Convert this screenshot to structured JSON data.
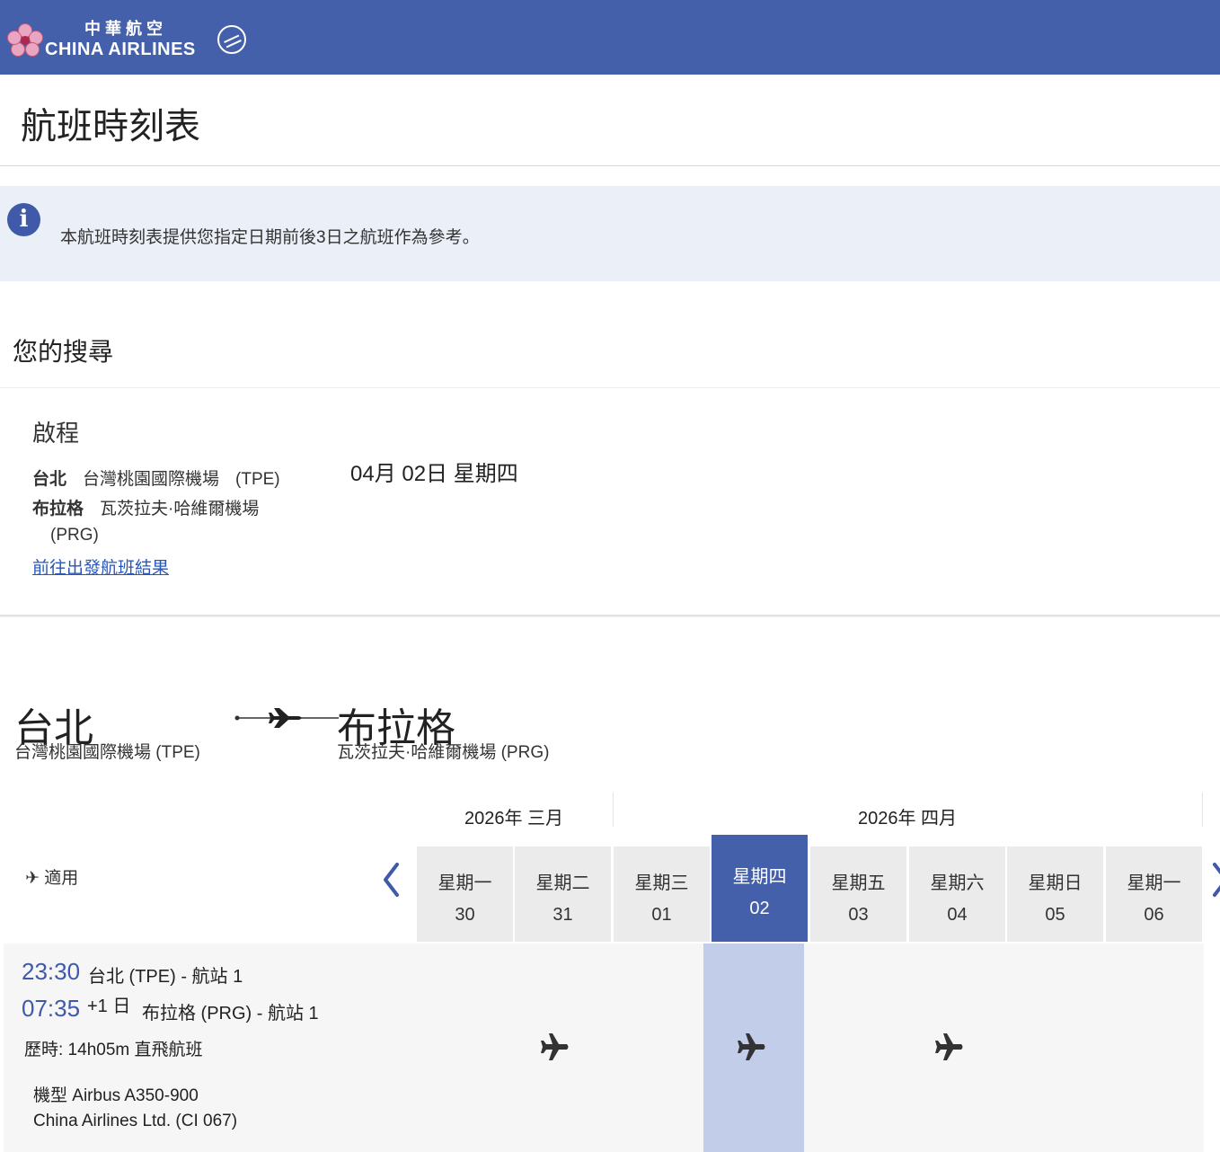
{
  "header": {
    "logo_cn": "中華航空",
    "logo_en": "CHINA AIRLINES",
    "brand_color": "#4560ab"
  },
  "page": {
    "title": "航班時刻表"
  },
  "info": {
    "icon": "info-icon",
    "text": "本航班時刻表提供您指定日期前後3日之航班作為參考。"
  },
  "search": {
    "heading": "您的搜尋",
    "leg_title": "啟程",
    "origin_city": "台北",
    "origin_airport": "台灣桃園國際機場",
    "origin_code": "(TPE)",
    "dest_city": "布拉格",
    "dest_airport": "瓦茨拉夫·哈維爾機場",
    "dest_code": "(PRG)",
    "date": "04月 02日 星期四",
    "link": "前往出發航班結果"
  },
  "route": {
    "from_city": "台北",
    "from_airport": "台灣桃園國際機場 (TPE)",
    "to_city": "布拉格",
    "to_airport": "瓦茨拉夫·哈維爾機場 (PRG)"
  },
  "calendar": {
    "months": [
      "2026年 三月",
      "2026年 四月"
    ],
    "filter_label": "適用",
    "days": [
      {
        "dow": "星期一",
        "num": "30"
      },
      {
        "dow": "星期二",
        "num": "31"
      },
      {
        "dow": "星期三",
        "num": "01"
      },
      {
        "dow": "星期四",
        "num": "02"
      },
      {
        "dow": "星期五",
        "num": "03"
      },
      {
        "dow": "星期六",
        "num": "04"
      },
      {
        "dow": "星期日",
        "num": "05"
      },
      {
        "dow": "星期一",
        "num": "06"
      }
    ],
    "selected_index": 3
  },
  "flight": {
    "dep_time": "23:30",
    "dep_stop": "台北 (TPE) - 航站 1",
    "arr_time": "07:35",
    "arr_plus": "+1 日",
    "arr_stop": "布拉格 (PRG) - 航站 1",
    "duration": "歷時: 14h05m 直飛航班",
    "aircraft": "機型 Airbus A350-900",
    "operator": "China Airlines Ltd. (CI 067)",
    "available_days": [
      "31",
      "02",
      "04"
    ]
  }
}
